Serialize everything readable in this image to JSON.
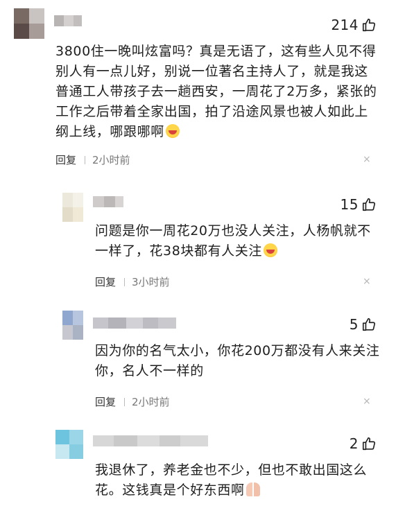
{
  "comments": [
    {
      "likes": "214",
      "text_lines": [
        "3800住一晚叫炫富吗？真是无语了，这有些人见不得",
        "别人有一点儿好，别说一位著名主持人了，就是我这",
        "普通工人带孩子去一趟西安，一周花了2万多，紧张的",
        "工作之后带着全家出国，拍了沿途风景也被人如此上",
        "纲上线，哪跟哪啊"
      ],
      "reply_label": "回复",
      "time": "2小时前"
    },
    {
      "likes": "15",
      "text_lines": [
        "问题是你一周花20万也没人关注，人杨帆就不",
        "一样了，花38块都有人关注"
      ],
      "reply_label": "回复",
      "time": "3小时前"
    },
    {
      "likes": "5",
      "text_lines": [
        "因为你的名气太小，你花200万都没有人来关注",
        "你，名人不一样的"
      ],
      "reply_label": "回复",
      "time": "2小时前"
    },
    {
      "likes": "2",
      "text_lines": [
        "我退休了，养老金也不少，但也不敢出国这么",
        "花。这钱真是个好东西啊"
      ]
    }
  ],
  "icons": {
    "like": "thumbs-up-icon",
    "close": "close-icon",
    "laugh_emoji": "laughing-crying-emoji",
    "pray_emoji": "praying-hands-emoji"
  },
  "close_glyph": "×"
}
